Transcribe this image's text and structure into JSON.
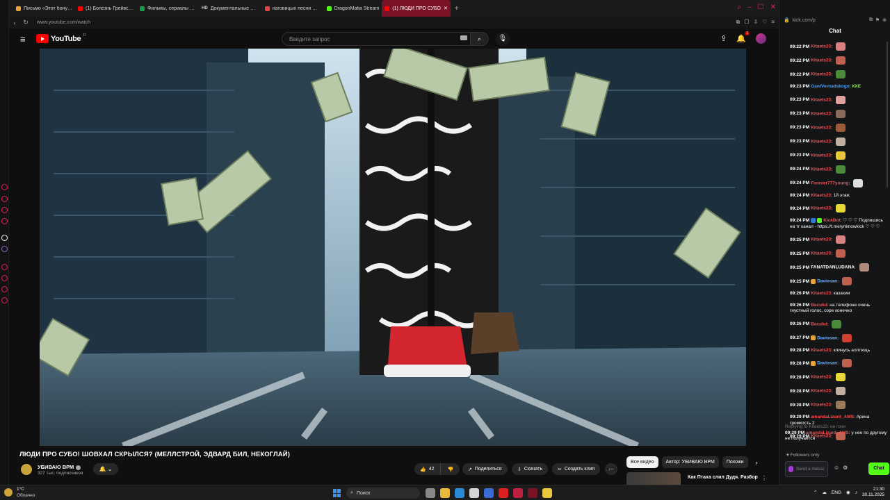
{
  "browser": {
    "tabs": [
      {
        "label": "Письмо «Этот бонус БЕЗ",
        "color": "#e8a33a"
      },
      {
        "label": "(1) Болезнь Грейвса - Те",
        "color": "#ff0000"
      },
      {
        "label": "Фильмы, сериалы и муз",
        "color": "#1a9a4a"
      },
      {
        "label": "Документальные филь",
        "color": "#ffffff",
        "prefix": "HD"
      },
      {
        "label": "наговицын песни — Янд",
        "color": "#e04545"
      },
      {
        "label": "DragonMafia Stream",
        "color": "#53fc18"
      },
      {
        "label": "(1) ЛЮДИ ПРО СУБО",
        "color": "#ff0000"
      }
    ],
    "new_tab": "+",
    "url": "www.youtube.com/watch",
    "kick_url": "kick.com/p"
  },
  "youtube": {
    "logo": "YouTube",
    "logo_region": "FI",
    "search_placeholder": "Введите запрос",
    "notification_count": "1",
    "video_title": "ЛЮДИ ПРО СУБО! ШОВХАЛ СКРЫЛСЯ? (МЕЛЛСТРОЙ, ЭДВАРД БИЛ, НЕКОГЛАЙ)",
    "channel_name": "УБИВАЮ ВРМ",
    "channel_subs": "327 тыс. подписчиков",
    "likes": "42",
    "share_label": "Поделиться",
    "download_label": "Скачать",
    "clip_label": "Создать клип",
    "chips": [
      "Все видео",
      "Автор: УБИВАЮ ВРМ",
      "Похожи"
    ],
    "rec_title": "Как Птаха слил Дудя. Разбор"
  },
  "kick": {
    "chat_title": "Chat",
    "messages": [
      {
        "time": "09:22 PM",
        "user": "Kitaets23",
        "color": "#ff4b4b",
        "text": "",
        "emote": "#d98080"
      },
      {
        "time": "09:22 PM",
        "user": "Kitaets23",
        "color": "#ff4b4b",
        "text": "",
        "emote": "#c06050"
      },
      {
        "time": "09:22 PM",
        "user": "Kitaets23",
        "color": "#ff4b4b",
        "text": "",
        "emote": "#4a8a3a"
      },
      {
        "time": "09:23 PM",
        "user": "GantVernadskogo",
        "color": "#4aa3ff",
        "text": "КХЕ",
        "textcolor": "#9be36a"
      },
      {
        "time": "09:23 PM",
        "user": "Kitaets23",
        "color": "#ff4b4b",
        "text": "",
        "emote": "#e0a0a0"
      },
      {
        "time": "09:23 PM",
        "user": "Kitaets23",
        "color": "#ff4b4b",
        "text": "",
        "emote": "#8a6a5a"
      },
      {
        "time": "09:23 PM",
        "user": "Kitaets23",
        "color": "#ff4b4b",
        "text": "",
        "emote": "#9a5a3a"
      },
      {
        "time": "09:23 PM",
        "user": "Kitaets23",
        "color": "#ff4b4b",
        "text": "",
        "emote": "#c0b0a0"
      },
      {
        "time": "09:23 PM",
        "user": "Kitaets23",
        "color": "#ff4b4b",
        "text": "",
        "emote": "#e8c73a"
      },
      {
        "time": "09:24 PM",
        "user": "Kitaets23",
        "color": "#ff4b4b",
        "text": "",
        "emote": "#4a8a3a"
      },
      {
        "time": "09:24 PM",
        "user": "Forever777young",
        "color": "#ff4b4b",
        "text": "",
        "emote": "#dddddd"
      },
      {
        "time": "09:24 PM",
        "user": "Kitaets23",
        "color": "#ff4b4b",
        "text": "1й этаж"
      },
      {
        "time": "09:24 PM",
        "user": "Kitaets23",
        "color": "#ff4b4b",
        "text": "",
        "emote": "#e8d83a"
      },
      {
        "time": "09:24 PM",
        "user": "KickBot",
        "color": "#ff4b4b",
        "text": "♡ ♡ ♡ Подпишись на тг канал - https://t.me/ynknowkick ♡ ♡ ♡",
        "badges": [
          "#2a7ad6",
          "#53fc18"
        ]
      },
      {
        "time": "09:25 PM",
        "user": "Kitaets23",
        "color": "#ff4b4b",
        "text": "",
        "emote": "#d98080"
      },
      {
        "time": "09:25 PM",
        "user": "Kitaets23",
        "color": "#ff4b4b",
        "text": "",
        "emote": "#c06050"
      },
      {
        "time": "09:25 PM",
        "user": "FANATDANLUDANA",
        "color": "#ffffff",
        "text": "",
        "emote": "#b08a7a"
      },
      {
        "time": "09:25 PM",
        "user": "Daviosan",
        "color": "#6ab0ff",
        "text": "",
        "emote": "#c06050",
        "badges": [
          "#e8a33a"
        ]
      },
      {
        "time": "09:26 PM",
        "user": "Kitaets23",
        "color": "#ff4b4b",
        "text": "казахии"
      },
      {
        "time": "09:26 PM",
        "user": "Bacului",
        "color": "#ff4b4b",
        "text": "на телефоне очень гнустный голос, соре конечно"
      },
      {
        "time": "09:26 PM",
        "user": "Bacului",
        "color": "#ff4b4b",
        "text": "",
        "emote": "#4a8a3a"
      },
      {
        "time": "09:27 PM",
        "user": "Daviosan",
        "color": "#6ab0ff",
        "text": "",
        "emote": "#d04030",
        "badges": [
          "#e8a33a"
        ]
      },
      {
        "time": "09:28 PM",
        "user": "Kitaets23",
        "color": "#ff4b4b",
        "text": "клинусь аллпхщь"
      },
      {
        "time": "09:28 PM",
        "user": "Daviosan",
        "color": "#6ab0ff",
        "text": "",
        "emote": "#c06050",
        "badges": [
          "#e8a33a"
        ]
      },
      {
        "time": "09:28 PM",
        "user": "Kitaets23",
        "color": "#ff4b4b",
        "text": "",
        "emote": "#e8d83a"
      },
      {
        "time": "09:28 PM",
        "user": "Kitaets23",
        "color": "#ff4b4b",
        "text": "",
        "emote": "#c0b0a0"
      },
      {
        "time": "09:28 PM",
        "user": "Kitaets23",
        "color": "#ff4b4b",
        "text": "",
        "emote": "#9a7a5a"
      },
      {
        "time": "09:29 PM",
        "user": "amandaLizard_AMS",
        "color": "#ff4b4b",
        "text": "Арина громкость 2"
      },
      {
        "time": "09:29 PM",
        "user": "Kitaets23",
        "color": "#ff4b4b",
        "text": "",
        "emote": "#c06050"
      },
      {
        "time": "09:29 PM",
        "user": "САШКО",
        "color": "#ffffff",
        "text": "",
        "emote": "#d86ab0"
      },
      {
        "time": "09:29 PM",
        "user": "Kitaets23",
        "color": "#ff4b4b",
        "text": "не гони"
      }
    ],
    "reply_to": "Replying to Kitaets23: не гони",
    "reply_time": "09:29 PM",
    "reply_user": "amandaLizard_AMS",
    "reply_text": "у нее по другому не получается",
    "followers_only": "Followers only",
    "input_placeholder": "Send a message",
    "send_label": "Chat"
  },
  "taskbar": {
    "temp": "1°C",
    "condition": "Облачно",
    "search_label": "Поиск",
    "lang": "ENG",
    "time": "21:30",
    "date": "30.11.2025"
  }
}
